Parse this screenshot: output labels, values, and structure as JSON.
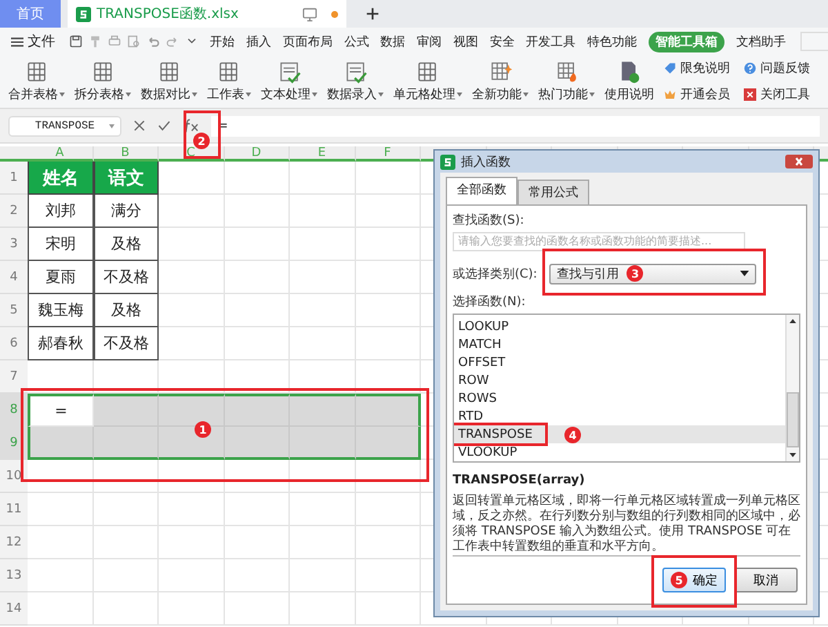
{
  "tabs": [
    {
      "label": "首页",
      "kind": "home",
      "selected": false
    },
    {
      "label": "TRANSPOSE函数.xlsx",
      "kind": "file",
      "selected": true
    }
  ],
  "menu": {
    "file_label": "文件",
    "items": [
      {
        "label": "开始",
        "selected": false
      },
      {
        "label": "插入",
        "selected": false
      },
      {
        "label": "页面布局",
        "selected": false
      },
      {
        "label": "公式",
        "selected": false
      },
      {
        "label": "数据",
        "selected": false
      },
      {
        "label": "审阅",
        "selected": false
      },
      {
        "label": "视图",
        "selected": false
      },
      {
        "label": "安全",
        "selected": false
      },
      {
        "label": "开发工具",
        "selected": false
      },
      {
        "label": "特色功能",
        "selected": false
      },
      {
        "label": "智能工具箱",
        "selected": true
      },
      {
        "label": "文档助手",
        "selected": false
      }
    ]
  },
  "toolbar": {
    "tools": [
      {
        "label": "合并表格",
        "dropdown": true
      },
      {
        "label": "拆分表格",
        "dropdown": true
      },
      {
        "label": "数据对比",
        "dropdown": true
      },
      {
        "label": "工作表",
        "dropdown": true
      },
      {
        "label": "文本处理",
        "dropdown": true
      },
      {
        "label": "数据录入",
        "dropdown": true
      },
      {
        "label": "单元格处理",
        "dropdown": true
      },
      {
        "label": "全新功能",
        "dropdown": true
      },
      {
        "label": "热门功能",
        "dropdown": true
      },
      {
        "label": "使用说明",
        "dropdown": false
      }
    ],
    "links": [
      {
        "label": "限免说明"
      },
      {
        "label": "开通会员"
      },
      {
        "label": "问题反馈"
      },
      {
        "label": "关闭工具"
      }
    ]
  },
  "formula_bar": {
    "name_box": "TRANSPOSE",
    "formula": "="
  },
  "sheet": {
    "columns": [
      "A",
      "B",
      "C",
      "D",
      "E",
      "F"
    ],
    "rows": [
      {
        "number": "1",
        "kind": "header",
        "selected": false,
        "cells": [
          "姓名",
          "语文"
        ]
      },
      {
        "number": "2",
        "kind": "data",
        "selected": false,
        "cells": [
          "刘邦",
          "满分"
        ]
      },
      {
        "number": "3",
        "kind": "data",
        "selected": false,
        "cells": [
          "宋明",
          "及格"
        ]
      },
      {
        "number": "4",
        "kind": "data",
        "selected": false,
        "cells": [
          "夏雨",
          "不及格"
        ]
      },
      {
        "number": "5",
        "kind": "data",
        "selected": false,
        "cells": [
          "魏玉梅",
          "及格"
        ]
      },
      {
        "number": "6",
        "kind": "data",
        "selected": false,
        "cells": [
          "郝春秋",
          "不及格"
        ]
      },
      {
        "number": "7",
        "kind": "blank",
        "selected": false,
        "cells": []
      },
      {
        "number": "8",
        "kind": "blank",
        "selected": true,
        "cells": [
          "="
        ]
      },
      {
        "number": "9",
        "kind": "blank",
        "selected": true,
        "cells": []
      },
      {
        "number": "10",
        "kind": "blank",
        "selected": false,
        "cells": []
      },
      {
        "number": "11",
        "kind": "blank",
        "selected": false,
        "cells": []
      },
      {
        "number": "12",
        "kind": "blank",
        "selected": false,
        "cells": []
      },
      {
        "number": "13",
        "kind": "blank",
        "selected": false,
        "cells": []
      },
      {
        "number": "14",
        "kind": "blank",
        "selected": false,
        "cells": []
      }
    ]
  },
  "dialog": {
    "title": "插入函数",
    "tabs": [
      {
        "label": "全部函数",
        "selected": true
      },
      {
        "label": "常用公式",
        "selected": false
      }
    ],
    "search_label": "查找函数(S):",
    "search_placeholder": "请输入您要查找的函数名称或函数功能的简要描述...",
    "category_label": "或选择类别(C):",
    "category": "查找与引用",
    "list_label": "选择函数(N):",
    "functions": [
      {
        "name": "LOOKUP",
        "selected": false
      },
      {
        "name": "MATCH",
        "selected": false
      },
      {
        "name": "OFFSET",
        "selected": false
      },
      {
        "name": "ROW",
        "selected": false
      },
      {
        "name": "ROWS",
        "selected": false
      },
      {
        "name": "RTD",
        "selected": false
      },
      {
        "name": "TRANSPOSE",
        "selected": true
      },
      {
        "name": "VLOOKUP",
        "selected": false
      }
    ],
    "signature": "TRANSPOSE(array)",
    "description": "返回转置单元格区域，即将一行单元格区域转置成一列单元格区域，反之亦然。在行列数分别与数组的行列数相同的区域中，必须将 TRANSPOSE 输入为数组公式。使用 TRANSPOSE 可在工作表中转置数组的垂直和水平方向。",
    "buttons": [
      {
        "label": "确定",
        "kind": "primary"
      },
      {
        "label": "取消",
        "kind": "secondary"
      }
    ]
  },
  "annotations": [
    {
      "number": "1"
    },
    {
      "number": "2"
    },
    {
      "number": "3"
    },
    {
      "number": "4"
    },
    {
      "number": "5"
    }
  ]
}
